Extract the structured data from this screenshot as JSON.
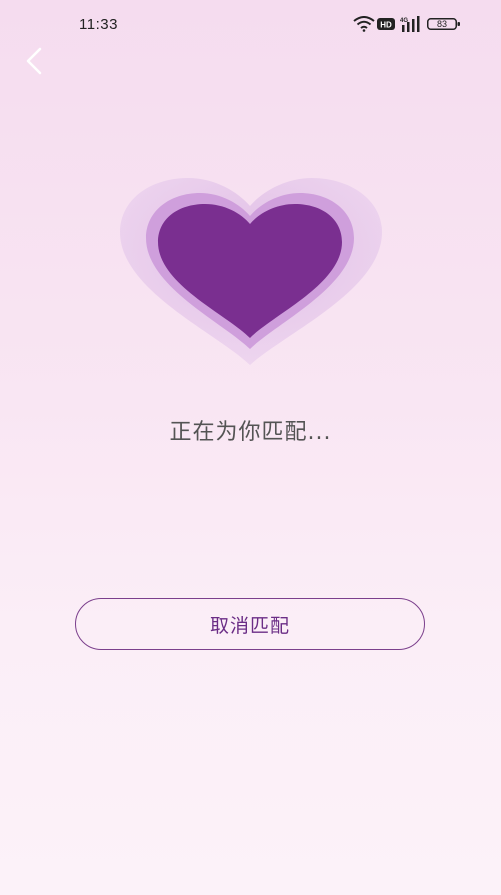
{
  "status_bar": {
    "time": "11:33",
    "hd_label": "HD",
    "network_label": "4G",
    "battery": "83"
  },
  "header": {
    "back_icon": "chevron-left-icon"
  },
  "main": {
    "heart_icon": "heart-icon",
    "matching_text": "正在为你匹配...",
    "cancel_label": "取消匹配"
  },
  "colors": {
    "heart_fill": "#7a2f90",
    "heart_halo_inner": "#cf9fdc",
    "heart_halo_outer": "#e6c6ea",
    "accent": "#6b2d86"
  }
}
